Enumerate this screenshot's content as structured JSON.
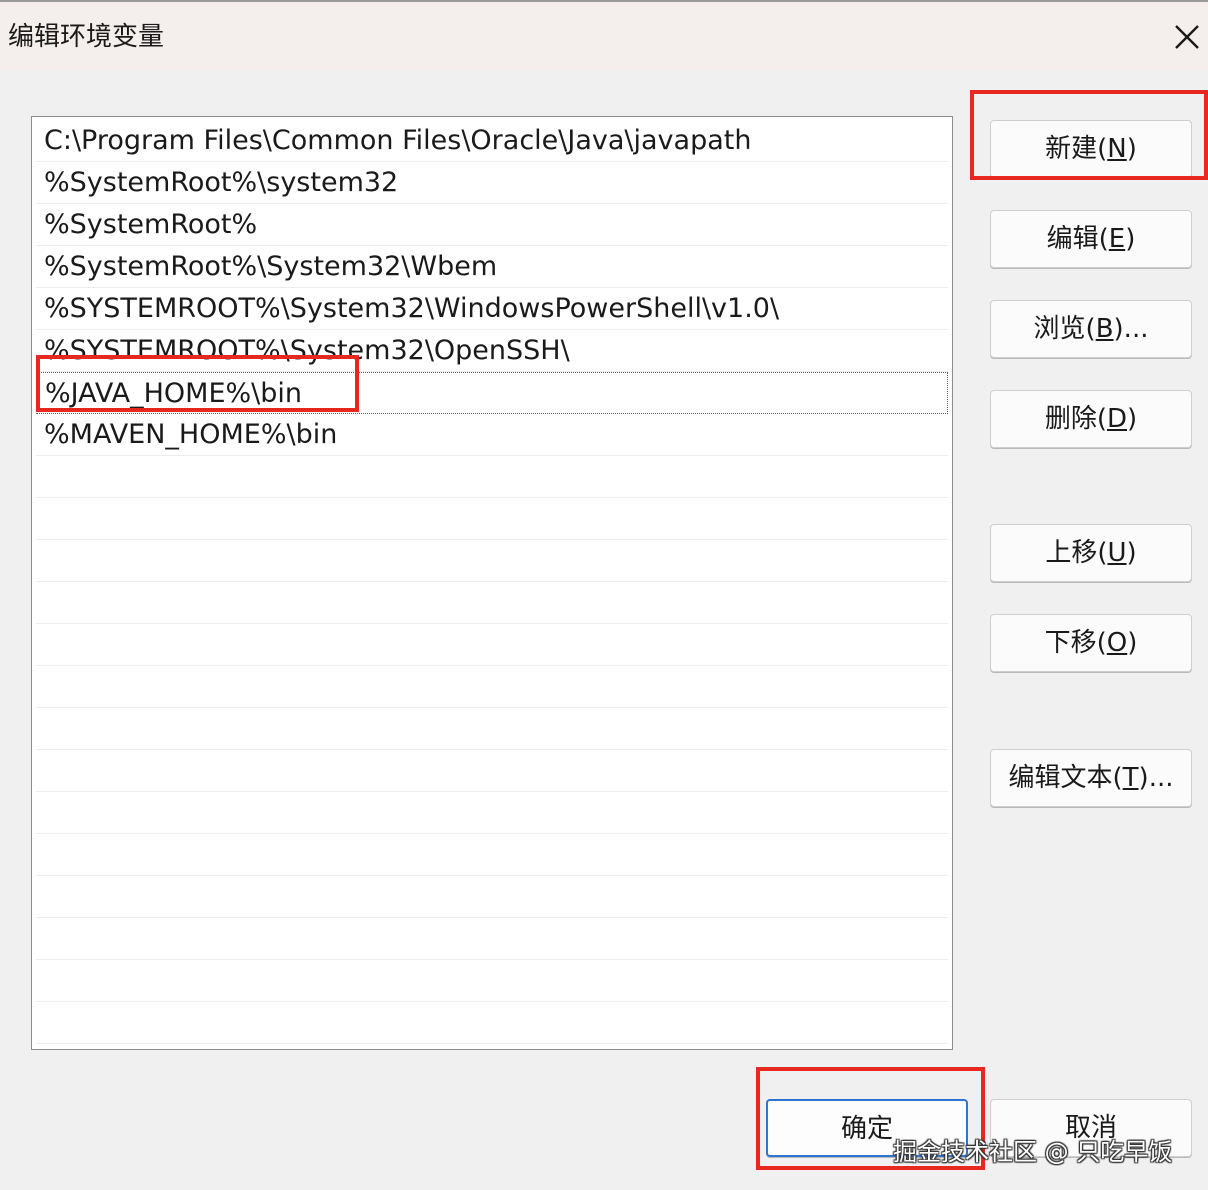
{
  "window": {
    "title": "编辑环境变量"
  },
  "path_entries": [
    "C:\\Program Files\\Common Files\\Oracle\\Java\\javapath",
    "%SystemRoot%\\system32",
    "%SystemRoot%",
    "%SystemRoot%\\System32\\Wbem",
    "%SYSTEMROOT%\\System32\\WindowsPowerShell\\v1.0\\",
    "%SYSTEMROOT%\\System32\\OpenSSH\\",
    "%JAVA_HOME%\\bin",
    "%MAVEN_HOME%\\bin"
  ],
  "selected_entry": "%JAVA_HOME%\\bin",
  "buttons": {
    "new": {
      "label": "新建(",
      "key": "N",
      "suffix": ")"
    },
    "edit": {
      "label": "编辑(",
      "key": "E",
      "suffix": ")"
    },
    "browse": {
      "label": "浏览(",
      "key": "B",
      "suffix": ")..."
    },
    "delete": {
      "label": "删除(",
      "key": "D",
      "suffix": ")"
    },
    "move_up": {
      "label": "上移(",
      "key": "U",
      "suffix": ")"
    },
    "move_down": {
      "label": "下移(",
      "key": "O",
      "suffix": ")"
    },
    "edit_text": {
      "label": "编辑文本(",
      "key": "T",
      "suffix": ")..."
    },
    "ok": "确定",
    "cancel": "取消"
  },
  "annotation": {
    "highlight_color": "#e8271f"
  },
  "watermark": "掘金技术社区 @ 只吃早饭"
}
